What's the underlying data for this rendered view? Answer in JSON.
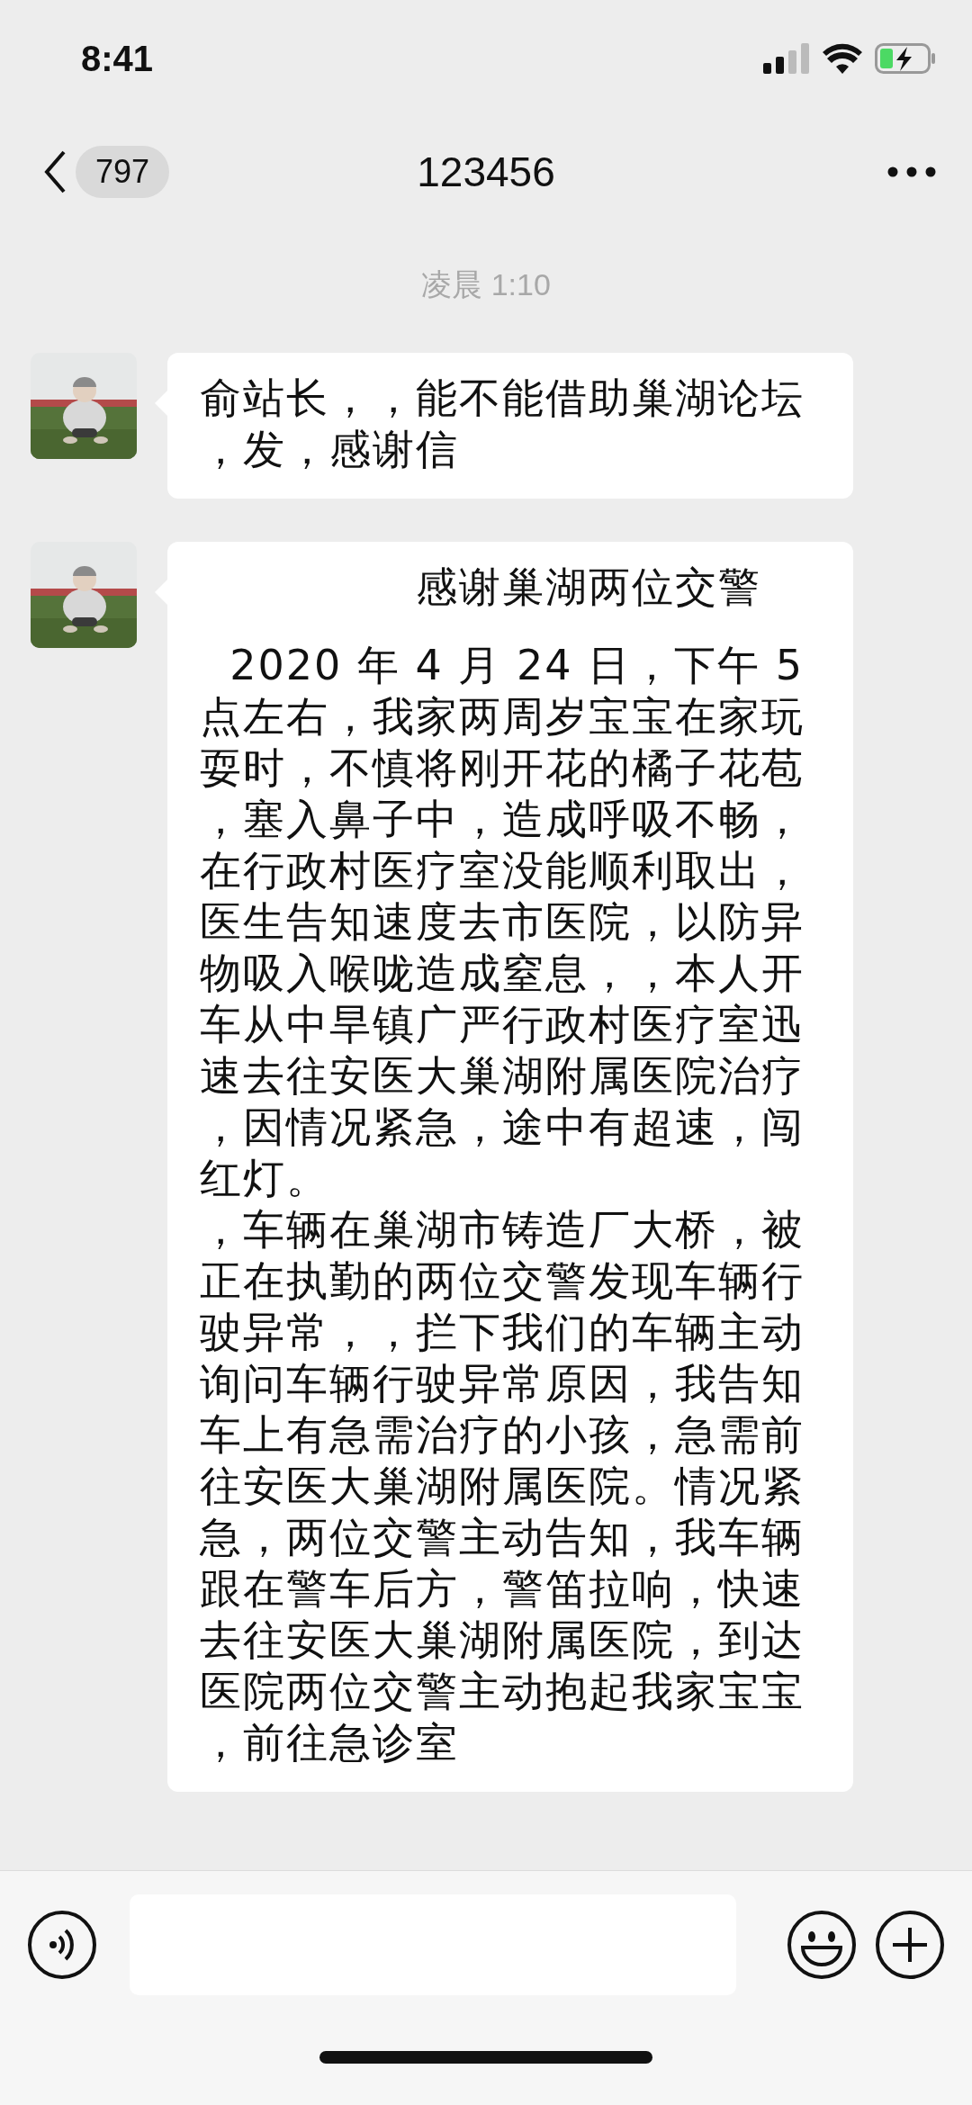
{
  "status_bar": {
    "time": "8:41"
  },
  "nav": {
    "back_count": "797",
    "title": "123456"
  },
  "timestamp": "凌晨 1:10",
  "messages": [
    {
      "kind": "text",
      "paragraphs": [
        {
          "kind": "body",
          "text": "俞站长，，能不能借助巢湖论坛，发，感谢信"
        }
      ]
    },
    {
      "kind": "text",
      "paragraphs": [
        {
          "kind": "heading",
          "text": "感谢巢湖两位交警"
        },
        {
          "kind": "body",
          "text": "  2020 年 4 月 24 日，下午 5 点左右，我家两周岁宝宝在家玩耍时，不慎将刚开花的橘子花苞，塞入鼻子中，造成呼吸不畅，在行政村医疗室没能顺利取出，医生告知速度去市医院，以防异物吸入喉咙造成窒息，，本人开车从中旱镇广严行政村医疗室迅速去往安医大巢湖附属医院治疗，因情况紧急，途中有超速，闯红灯。"
        },
        {
          "kind": "body",
          "text": "，车辆在巢湖市铸造厂大桥，被正在执勤的两位交警发现车辆行驶异常，，拦下我们的车辆主动询问车辆行驶异常原因，我告知车上有急需治疗的小孩，急需前往安医大巢湖附属医院。情况紧急，两位交警主动告知，我车辆跟在警车后方，警笛拉响，快速去往安医大巢湖附属医院，到达医院两位交警主动抱起我家宝宝，前往急诊室"
        }
      ]
    }
  ]
}
